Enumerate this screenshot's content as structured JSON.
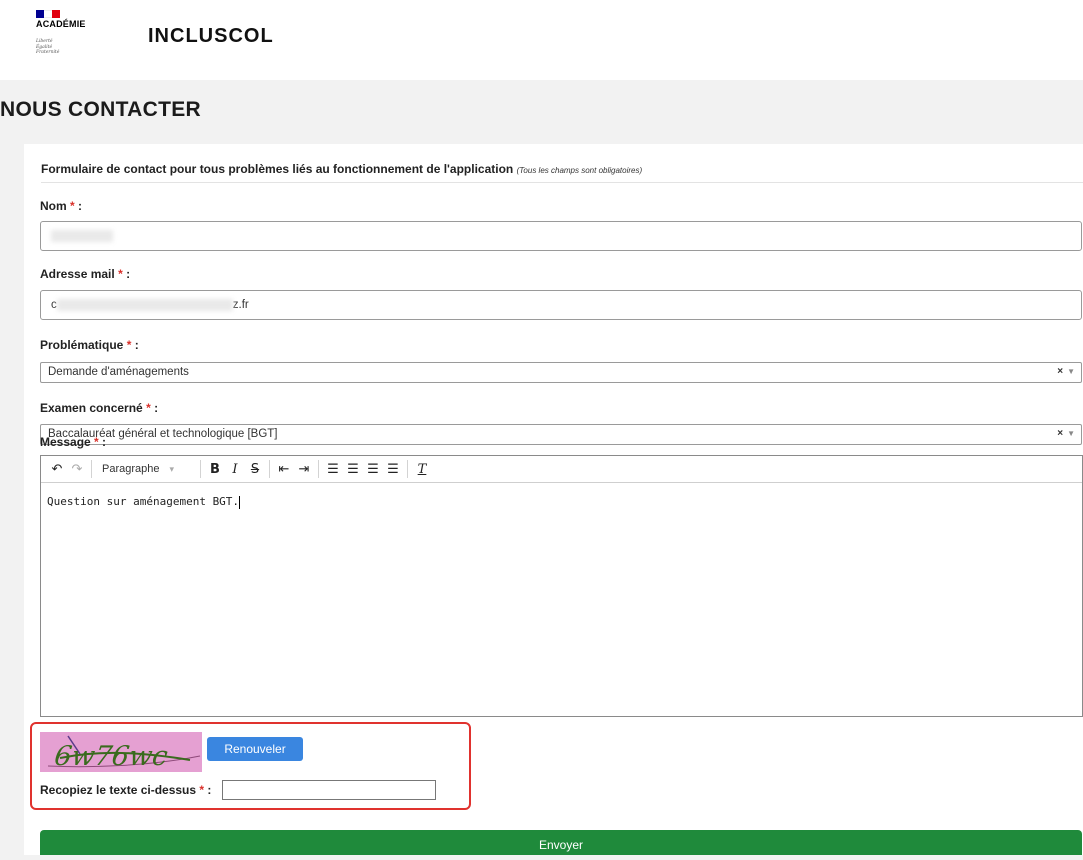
{
  "header": {
    "logo_text": "ACADÉMIE",
    "motto": [
      "Liberté",
      "Égalité",
      "Fraternité"
    ],
    "app_name": "INCLUSCOL",
    "flag_colors": [
      "#000091",
      "#ffffff",
      "#e1000f"
    ]
  },
  "page": {
    "title": "NOUS CONTACTER"
  },
  "form": {
    "heading": "Formulaire de contact pour tous problèmes liés au fonctionnement de l'application",
    "heading_note": "(Tous les champs sont obligatoires)",
    "required_marker": "*",
    "nom": {
      "label": "Nom"
    },
    "email": {
      "label": "Adresse mail",
      "value_start": "c",
      "value_end": "z.fr"
    },
    "problematique": {
      "label": "Problématique",
      "value": "Demande d'aménagements"
    },
    "examen": {
      "label": "Examen concerné",
      "value": "Baccalauréat général et technologique [BGT]"
    },
    "message": {
      "label": "Message",
      "toolbar_format": "Paragraphe",
      "content": "Question sur aménagement BGT."
    },
    "captcha": {
      "image_text": "6w76wc",
      "renew_label": "Renouveler",
      "input_label": "Recopiez le texte ci-dessus"
    },
    "submit_label": "Envoyer"
  },
  "colors": {
    "required": "#d9302a",
    "submit": "#1f8a3b",
    "renew": "#3a86e0",
    "highlight_border": "#e0322e",
    "captcha_bg": "#e5a0d2"
  }
}
